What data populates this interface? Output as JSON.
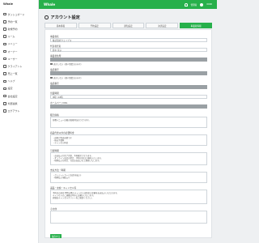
{
  "sidebar": {
    "brand": "Whale",
    "items": [
      {
        "label": "ダッシュボード",
        "icon": "dashboard-icon"
      },
      {
        "label": "予約一覧",
        "icon": "calendar-icon"
      },
      {
        "label": "新規予約",
        "icon": "plus-icon"
      },
      {
        "label": "ルーム",
        "icon": "room-icon"
      },
      {
        "label": "メニュー",
        "icon": "menu-icon"
      },
      {
        "label": "オーナー",
        "icon": "owner-icon"
      },
      {
        "label": "ユーザー",
        "icon": "user-icon"
      },
      {
        "label": "クライアント",
        "icon": "client-icon"
      },
      {
        "label": "売上一覧",
        "icon": "chart-icon"
      },
      {
        "label": "ヘルプ",
        "icon": "help-icon"
      },
      {
        "label": "設定",
        "icon": "settings-icon"
      },
      {
        "label": "会社設定",
        "icon": "company-icon"
      },
      {
        "label": "外部連携",
        "icon": "link-icon"
      },
      {
        "label": "ログアウト",
        "icon": "logout-icon"
      }
    ]
  },
  "header": {
    "logo": "Whale",
    "user_name": "管理者",
    "shop_code": "0000"
  },
  "page": {
    "title": "アカウント設定"
  },
  "tabs": [
    {
      "label": "基本情報",
      "active": false
    },
    {
      "label": "予約設定",
      "active": false
    },
    {
      "label": "通知設定",
      "active": false
    },
    {
      "label": "決済設定",
      "active": false
    },
    {
      "label": "事業者情報",
      "active": true
    }
  ],
  "form": {
    "company_label": "事業者名",
    "company_value": "株式会社ウェイブス",
    "representative_label": "代表者氏名",
    "representative_value": "鈴木 花子",
    "address_label": "事業者住所",
    "checkbox1": "表示しない（個人事業主のみ可）",
    "phone_label": "電話番号",
    "checkbox2": "表示しない（個人事業主のみ可）",
    "email_label": "電話番号",
    "business_hours_label": "営業時間",
    "business_hours_value": "9時〜18時",
    "homepage_label": "ホームページURL",
    "price_label": "販売価格",
    "price_text": "各種メニュー記載の価格(税込)となります。",
    "extra_fee_label": "商品代金以外の必要料金",
    "extra_fee_lines": [
      "・送料が別途必要です",
      "・振込手数料",
      "・キャンセル料金"
    ],
    "delivery_label": "引渡時期",
    "delivery_lines": [
      "・お支払いが完了次第、予約確定となります。",
      "・オンライン決済の場合、予約日当日に施術いたします。",
      "・現地払いの場合、当日お支払いの上施術いたします。"
    ],
    "payment_label": "支払方法・時期",
    "payment_lines": [
      "・クレジットカード決済(前払い)",
      "・現地払い(後払い)"
    ],
    "cancel_label": "返品・交換・キャンセル等",
    "cancel_lines": [
      "予約日の前日18時以降のキャンセルは料金の全額をお支払いいただきます。",
      "キャンセルのご連絡は早めにお願いいたします。",
      "詳細はキャンセルポリシーをご確認ください。"
    ],
    "note_label": "その他",
    "save_label": "保存する"
  }
}
